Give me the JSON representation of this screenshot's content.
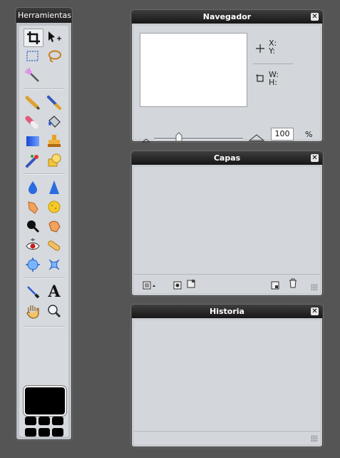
{
  "tools_panel": {
    "title": "Herramientas",
    "tools": [
      {
        "name": "crop-tool-icon"
      },
      {
        "name": "move-tool-icon"
      },
      {
        "name": "marquee-select-tool-icon"
      },
      {
        "name": "lasso-tool-icon"
      },
      {
        "name": "magic-wand-tool-icon"
      },
      {
        "name": "pencil-tool-icon"
      },
      {
        "name": "brush-tool-icon"
      },
      {
        "name": "eraser-tool-icon"
      },
      {
        "name": "paint-bucket-tool-icon"
      },
      {
        "name": "gradient-tool-icon"
      },
      {
        "name": "clone-stamp-tool-icon"
      },
      {
        "name": "color-replace-tool-icon"
      },
      {
        "name": "shape-tool-icon"
      },
      {
        "name": "blur-tool-icon"
      },
      {
        "name": "sharpen-tool-icon"
      },
      {
        "name": "smudge-tool-icon"
      },
      {
        "name": "sponge-tool-icon"
      },
      {
        "name": "dodge-tool-icon"
      },
      {
        "name": "burn-tool-icon"
      },
      {
        "name": "red-eye-tool-icon"
      },
      {
        "name": "spot-heal-tool-icon"
      },
      {
        "name": "bloat-tool-icon"
      },
      {
        "name": "pinch-tool-icon"
      },
      {
        "name": "eyedropper-tool-icon"
      },
      {
        "name": "text-tool-icon"
      },
      {
        "name": "hand-tool-icon"
      },
      {
        "name": "zoom-tool-icon"
      }
    ],
    "text_tool_glyph": "A",
    "foreground_color": "#000000"
  },
  "navigator": {
    "title": "Navegador",
    "x_label": "X:",
    "y_label": "Y:",
    "w_label": "W:",
    "h_label": "H:",
    "zoom_value": "100",
    "zoom_unit": "%",
    "zoom_level": 100
  },
  "layers": {
    "title": "Capas"
  },
  "history": {
    "title": "Historia"
  },
  "close_glyph": "✕"
}
